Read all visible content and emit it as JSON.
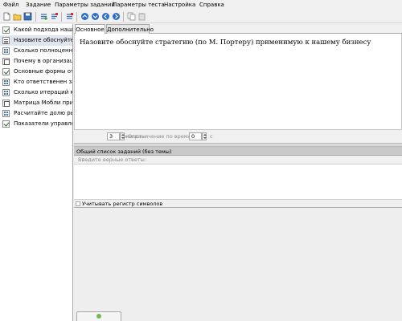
{
  "menu": [
    "Файл",
    "Задание",
    "Параметры заданий",
    "Параметры теста",
    "Настройка",
    "Справка"
  ],
  "toolbar_icons": [
    "new-file-icon",
    "open-folder-icon",
    "save-icon",
    "add-task-icon",
    "delete-task-icon",
    "settings-icon",
    "move-up-icon",
    "move-down-icon",
    "move-left-icon",
    "move-right-icon",
    "copy-icon",
    "paste-icon"
  ],
  "tasks": [
    {
      "label": "Какой подхода наша ком",
      "icon": "check"
    },
    {
      "label": "Назовите обоснуйте стр",
      "icon": "text"
    },
    {
      "label": "Сколько полноценных бизн",
      "icon": "order"
    },
    {
      "label": "Почему в организации",
      "icon": "match"
    },
    {
      "label": "Основные формы отчетн",
      "icon": "check"
    },
    {
      "label": "Кто ответственен за ис",
      "icon": "order"
    },
    {
      "label": "Сколько итераций може",
      "icon": "order"
    },
    {
      "label": "Матрица Мобли примени",
      "icon": "match"
    },
    {
      "label": "Расчитайте долю рынка",
      "icon": "order"
    },
    {
      "label": "Показатели управлени",
      "icon": "check"
    }
  ],
  "tabs": [
    "Основное",
    "Дополнительно"
  ],
  "question_text": "Назовите обоснуйте стратегию (по М. Портеру) применимую к нашему бизнесу",
  "params": {
    "difficulty_label": "Сложность:",
    "difficulty_value": "3",
    "time_limit_label": "Ограничение по времени:",
    "time_limit_value": "0",
    "time_unit": "с"
  },
  "group_title": "Общий список заданий (без темы)",
  "answers_hint": "Введите верные ответы:",
  "case_sensitive_label": "Учитывать регистр символов"
}
